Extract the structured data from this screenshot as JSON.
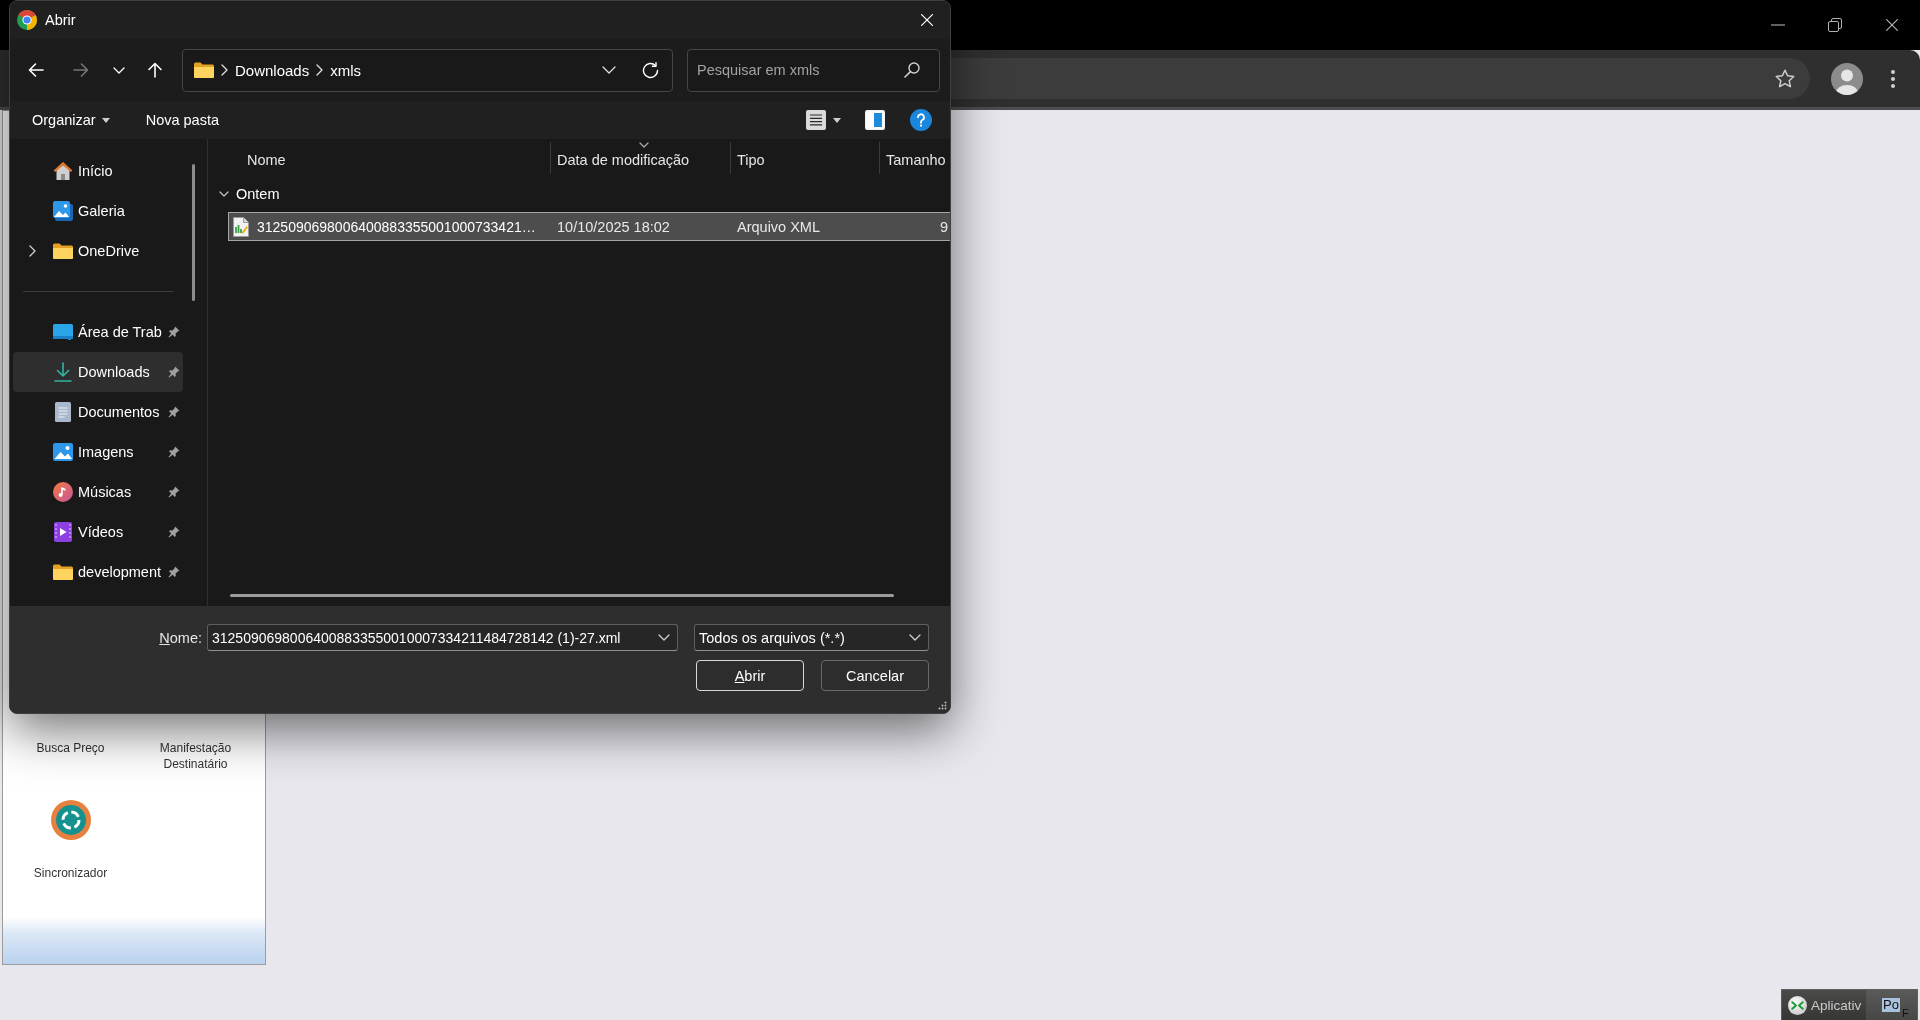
{
  "dialog": {
    "title": "Abrir",
    "nav_buttons": [
      {
        "kind": "back",
        "disabled": false
      },
      {
        "kind": "forward",
        "disabled": true
      },
      {
        "kind": "recent",
        "disabled": false
      },
      {
        "kind": "up",
        "disabled": false
      }
    ],
    "breadcrumb": [
      "Downloads",
      "xmls"
    ],
    "search": {
      "placeholder": "Pesquisar em xmls"
    },
    "commands": [
      {
        "label": "Organizar",
        "kind": "menu"
      },
      {
        "label": "Nova pasta",
        "kind": "button"
      }
    ],
    "sidebar": {
      "groups": [
        {
          "items": [
            {
              "label": "Início",
              "kind": "home",
              "pinned": false,
              "selected": false
            },
            {
              "label": "Galeria",
              "kind": "gallery",
              "pinned": false,
              "selected": false
            },
            {
              "label": "OneDrive",
              "kind": "folder",
              "pinned": false,
              "selected": false,
              "expanded": false
            }
          ]
        },
        {
          "items": [
            {
              "label": "Área de Trab",
              "kind": "desktop",
              "pinned": true,
              "selected": false
            },
            {
              "label": "Downloads",
              "kind": "download",
              "pinned": true,
              "selected": true
            },
            {
              "label": "Documentos",
              "kind": "document",
              "pinned": true,
              "selected": false
            },
            {
              "label": "Imagens",
              "kind": "pictures",
              "pinned": true,
              "selected": false
            },
            {
              "label": "Músicas",
              "kind": "music",
              "pinned": true,
              "selected": false
            },
            {
              "label": "Vídeos",
              "kind": "video",
              "pinned": true,
              "selected": false
            },
            {
              "label": "development",
              "kind": "folder",
              "pinned": true,
              "selected": false
            }
          ]
        }
      ]
    },
    "file_list": {
      "columns": [
        {
          "label": "Nome",
          "sorted": false
        },
        {
          "label": "Data de modificação",
          "sorted": true
        },
        {
          "label": "Tipo",
          "sorted": false
        },
        {
          "label": "Tamanho",
          "sorted": false
        }
      ],
      "groups": [
        {
          "label": "Ontem",
          "expanded": true,
          "rows": [
            {
              "name": "3125090698006400883355001000733421…",
              "modified": "10/10/2025 18:02",
              "type": "Arquivo XML",
              "size": "9",
              "selected": true
            }
          ]
        }
      ]
    },
    "file_name": {
      "label": "Nome:",
      "mnemonic_underlined": true,
      "value": "31250906980064008833550010007334211484728142 (1)-27.xml"
    },
    "file_type": {
      "value": "Todos os arquivos (*.*)"
    },
    "buttons": [
      {
        "label": "Abrir",
        "default": true,
        "mnemonic_underlined": true
      },
      {
        "label": "Cancelar",
        "default": false,
        "mnemonic_underlined": false
      }
    ]
  },
  "app_panel": {
    "tiles": [
      {
        "label": "Busca Preço"
      },
      {
        "label": "Manifestação Destinatário"
      },
      {
        "label": "Sincronizador",
        "kind": "sync"
      }
    ]
  },
  "taskbar": {
    "items": [
      {
        "label": "Aplicativ",
        "kind": "app",
        "selected": false
      },
      {
        "label": "Po",
        "kind": "window",
        "selected": true,
        "corner_text": "F"
      }
    ]
  }
}
